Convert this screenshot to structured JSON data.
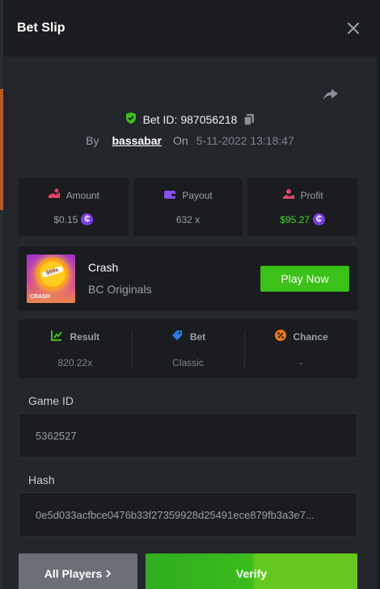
{
  "modal": {
    "title": "Bet Slip"
  },
  "bet": {
    "id_label": "Bet ID:",
    "id": "987056218",
    "by_label": "By",
    "user": "bassabar",
    "on_label": "On",
    "date": "5-11-2022 13:18:47"
  },
  "stats": {
    "amount": {
      "label": "Amount",
      "value": "$0.15"
    },
    "payout": {
      "label": "Payout",
      "value": "632 x"
    },
    "profit": {
      "label": "Profit",
      "value": "$95.27"
    }
  },
  "game": {
    "name": "Crash",
    "provider": "BC Originals",
    "thumb_number": "999x",
    "thumb_tag": "CRASH",
    "play_label": "Play Now"
  },
  "details": {
    "result": {
      "label": "Result",
      "value": "820.22x"
    },
    "bet": {
      "label": "Bet",
      "value": "Classic"
    },
    "chance": {
      "label": "Chance",
      "value": "-"
    }
  },
  "fields": {
    "game_id": {
      "label": "Game ID",
      "value": "5362527"
    },
    "hash": {
      "label": "Hash",
      "value": "0e5d033acfbce0476b33f27359928d25491ece879fb3a3e7..."
    }
  },
  "actions": {
    "players_label": "All Players",
    "verify_label": "Verify"
  },
  "coin_symbol": "₵",
  "colors": {
    "accent_green": "#3bc117",
    "profit_green": "#4bd234",
    "coin_purple": "#7b3fe4",
    "panel_bg": "#1a1c1f"
  }
}
